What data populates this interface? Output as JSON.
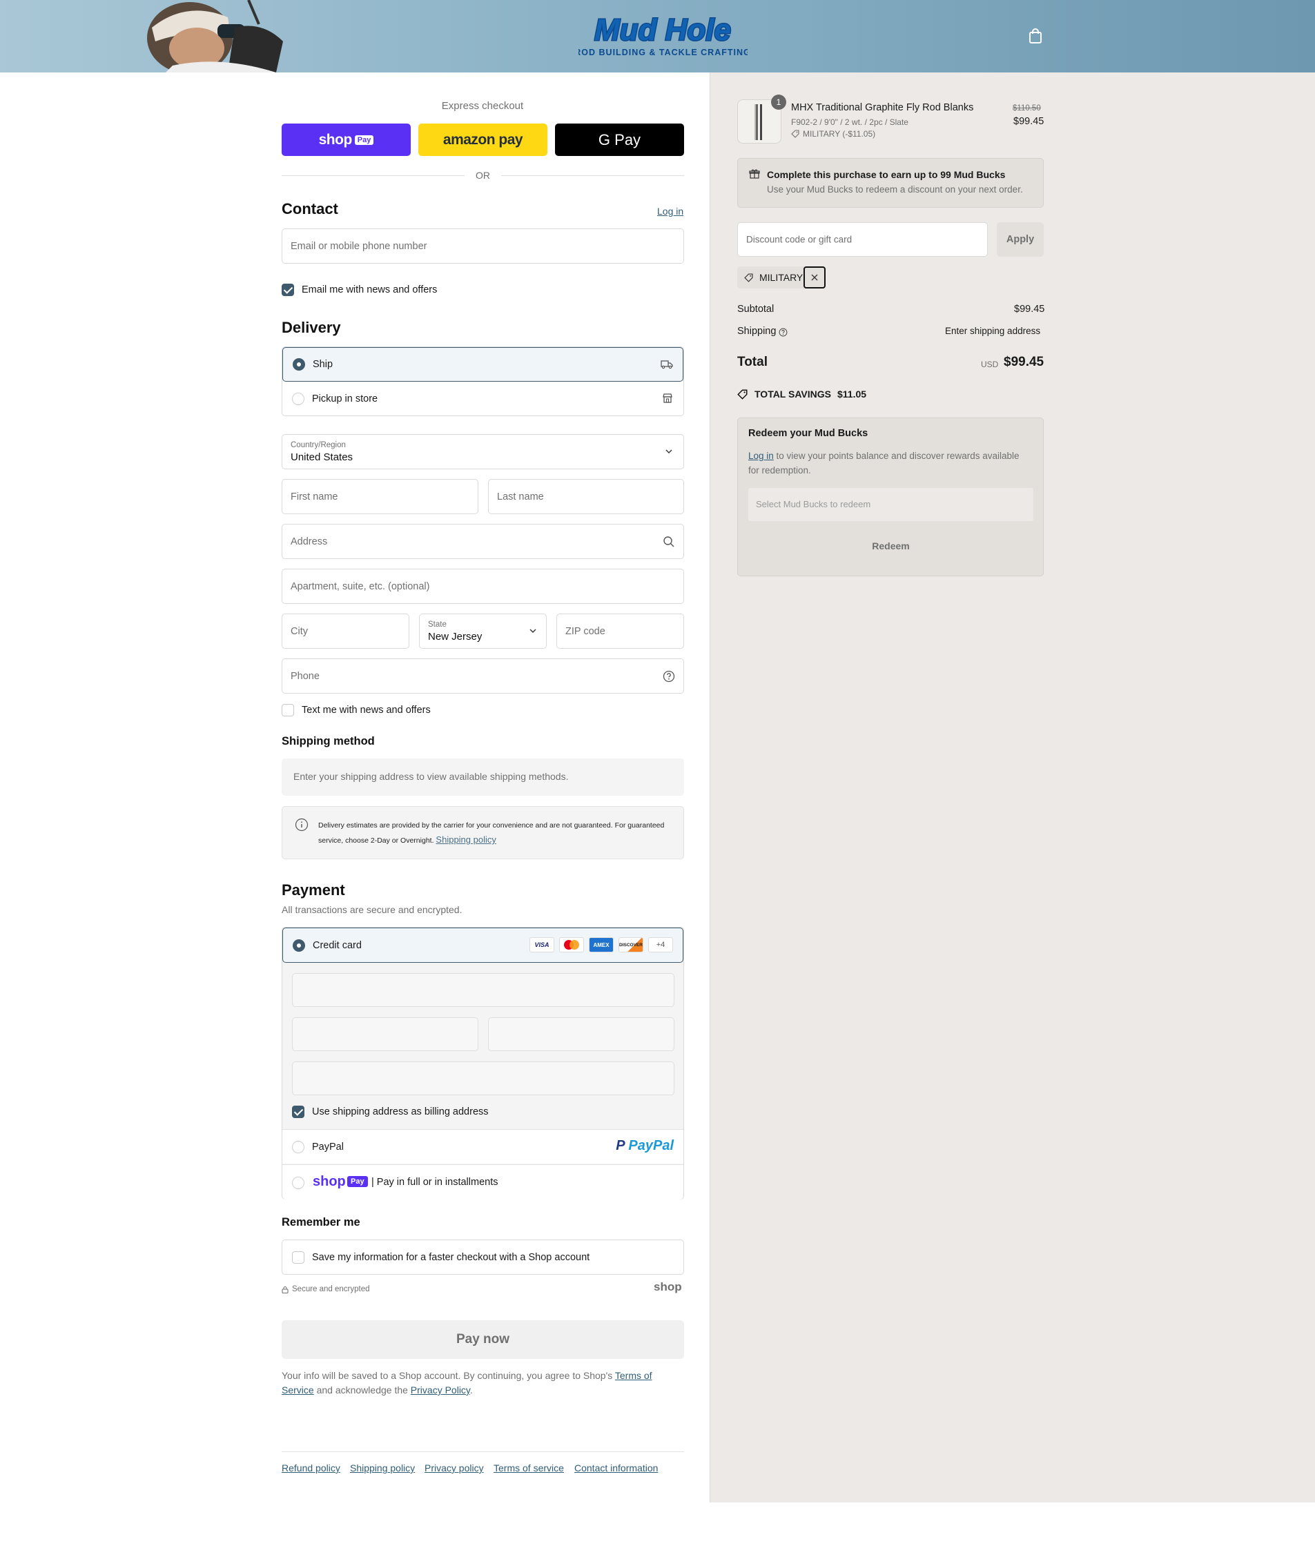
{
  "header": {
    "logo_main": "Mud Hole",
    "logo_sub": "ROD BUILDING & TACKLE CRAFTING",
    "cart_icon": "shopping-bag-icon"
  },
  "express": {
    "label": "Express checkout",
    "shop_pay": "shop",
    "shop_pay_badge": "Pay",
    "amazon_pay": "amazon pay",
    "google_pay": "G Pay",
    "divider": "OR"
  },
  "contact": {
    "title": "Contact",
    "login": "Log in",
    "email_placeholder": "Email or mobile phone number",
    "email_opt_in": "Email me with news and offers",
    "email_opt_in_checked": true
  },
  "delivery": {
    "title": "Delivery",
    "options": [
      {
        "label": "Ship",
        "selected": true,
        "icon": "truck-icon"
      },
      {
        "label": "Pickup in store",
        "selected": false,
        "icon": "store-icon"
      }
    ],
    "country_label": "Country/Region",
    "country_value": "United States",
    "first_name": "First name",
    "last_name": "Last name",
    "address": "Address",
    "apartment": "Apartment, suite, etc. (optional)",
    "city": "City",
    "state_label": "State",
    "state_value": "New Jersey",
    "zip": "ZIP code",
    "phone": "Phone",
    "sms_opt_in": "Text me with news and offers"
  },
  "shipping_method": {
    "title": "Shipping method",
    "empty": "Enter your shipping address to view available shipping methods.",
    "notice_line1": "Delivery estimates are provided by the carrier for your convenience and are not guaranteed. For guaranteed",
    "notice_line2": "service, choose 2-Day or Overnight.",
    "notice_link": "Shipping policy"
  },
  "payment": {
    "title": "Payment",
    "subtitle": "All transactions are secure and encrypted.",
    "credit_card": "Credit card",
    "card_brands": [
      "VISA",
      "MC",
      "AMEX",
      "DISCOVER"
    ],
    "more_brands": "+4",
    "billing_same": "Use shipping address as billing address",
    "paypal": "PayPal",
    "paypal_logo": "PayPal",
    "shop_pay_logo": "shop",
    "shop_pay_badge": "Pay",
    "shop_pay_label": "| Pay in full or in installments"
  },
  "remember": {
    "title": "Remember me",
    "save_info": "Save my information for a faster checkout with a Shop account",
    "secure": "Secure and encrypted",
    "shop_brand": "shop"
  },
  "pay_now": "Pay now",
  "legal": {
    "text1": "Your info will be saved to a Shop account. By continuing, you agree to Shop's ",
    "terms": "Terms of",
    "terms2": "Service",
    "text2": " and acknowledge the ",
    "privacy": "Privacy Policy",
    "text3": "."
  },
  "footer": [
    "Refund policy",
    "Shipping policy",
    "Privacy policy",
    "Terms of service",
    "Contact information"
  ],
  "summary": {
    "quantity": "1",
    "product_name": "MHX Traditional Graphite Fly Rod Blanks",
    "product_variant": "F902-2 / 9'0\" / 2 wt. / 2pc / Slate",
    "product_discount": "MILITARY (-$11.05)",
    "original_price": "$110.50",
    "price": "$99.45",
    "rewards_title": "Complete this purchase to earn up to 99 Mud Bucks",
    "rewards_sub": "Use your Mud Bucks to redeem a discount on your next order.",
    "discount_placeholder": "Discount code or gift card",
    "apply": "Apply",
    "applied_code": "MILITARY",
    "subtotal_label": "Subtotal",
    "subtotal": "$99.45",
    "shipping_label": "Shipping",
    "shipping_value": "Enter shipping address",
    "total_label": "Total",
    "currency": "USD",
    "total": "$99.45",
    "savings_label": "TOTAL SAVINGS",
    "savings": "$11.05",
    "redeem_title": "Redeem your Mud Bucks",
    "redeem_login": "Log in",
    "redeem_text1": " to view your points balance and discover rewards available",
    "redeem_text2": "for redemption.",
    "redeem_select": "Select Mud Bucks to redeem",
    "redeem_button": "Redeem"
  },
  "colors": {
    "accent": "#3f5a6c",
    "shop_purple": "#5a31f4",
    "amazon_yellow": "#ffd814",
    "summary_bg": "#ece9e6"
  }
}
